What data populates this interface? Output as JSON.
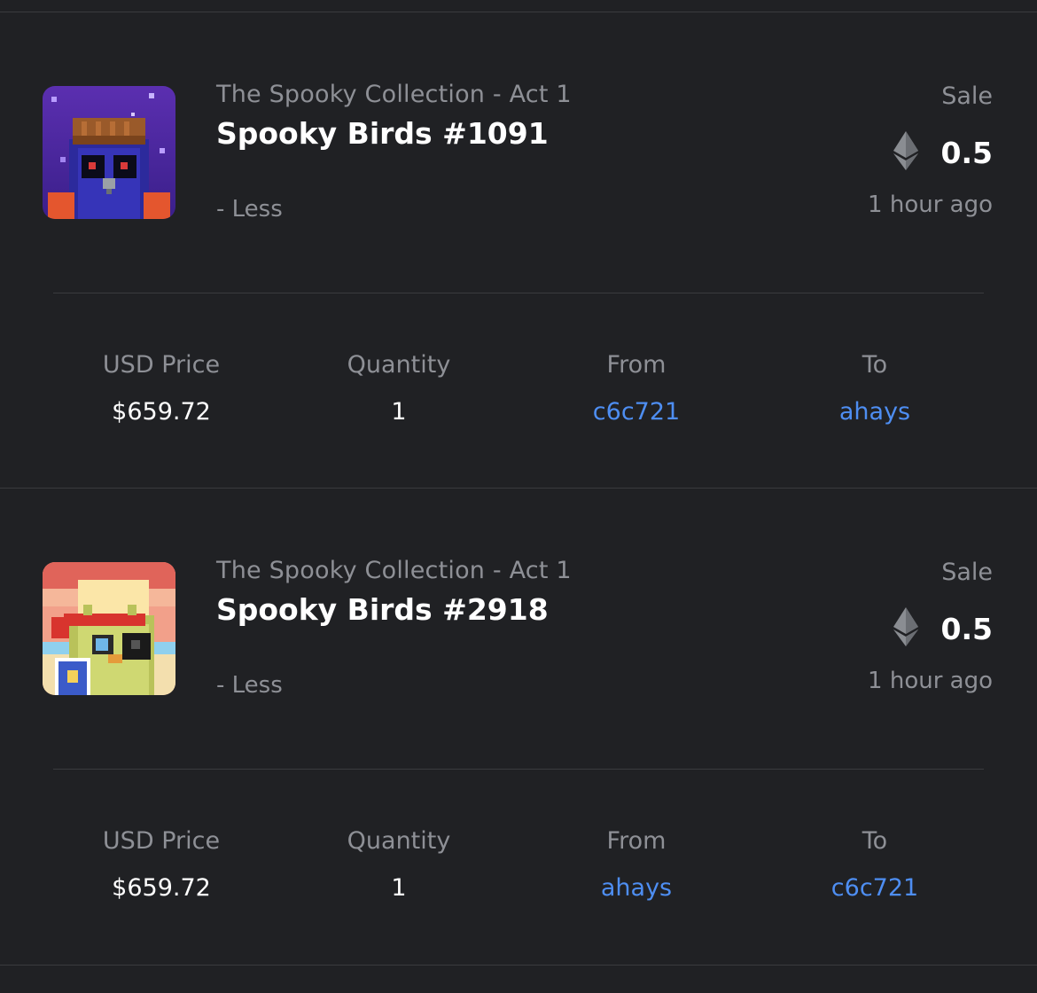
{
  "activities": [
    {
      "collection": "The Spooky Collection - Act 1",
      "name": "Spooky Birds #1091",
      "less_label": "- Less",
      "event_type": "Sale",
      "currency_icon": "ethereum-icon",
      "price": "0.5",
      "time_ago": "1 hour ago",
      "details": {
        "usd_label": "USD Price",
        "usd_value": "$659.72",
        "quantity_label": "Quantity",
        "quantity_value": "1",
        "from_label": "From",
        "from_value": "c6c721",
        "to_label": "To",
        "to_value": "ahays"
      }
    },
    {
      "collection": "The Spooky Collection - Act 1",
      "name": "Spooky Birds #2918",
      "less_label": "- Less",
      "event_type": "Sale",
      "currency_icon": "ethereum-icon",
      "price": "0.5",
      "time_ago": "1 hour ago",
      "details": {
        "usd_label": "USD Price",
        "usd_value": "$659.72",
        "quantity_label": "Quantity",
        "quantity_value": "1",
        "from_label": "From",
        "from_value": "ahays",
        "to_label": "To",
        "to_value": "c6c721"
      }
    }
  ],
  "colors": {
    "background": "#202124",
    "divider": "#3a3b3e",
    "muted_text": "#8e9096",
    "link": "#4e8ef2"
  }
}
